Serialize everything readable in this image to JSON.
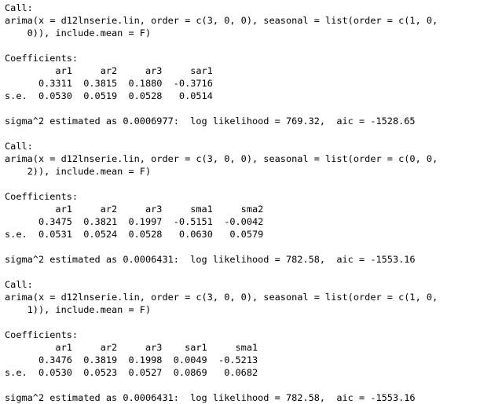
{
  "models": [
    {
      "call_label": "Call:",
      "call_line1": "arima(x = d12lnserie.lin, order = c(3, 0, 0), seasonal = list(order = c(1, 0,",
      "call_line2": "    0)), include.mean = F)",
      "coef_label": "Coefficients:",
      "coef_header": "         ar1     ar2     ar3     sar1",
      "coef_values": "      0.3311  0.3815  0.1880  -0.3716",
      "coef_se": "s.e.  0.0530  0.0519  0.0528   0.0514",
      "summary": "sigma^2 estimated as 0.0006977:  log likelihood = 769.32,  aic = -1528.65"
    },
    {
      "call_label": "Call:",
      "call_line1": "arima(x = d12lnserie.lin, order = c(3, 0, 0), seasonal = list(order = c(0, 0,",
      "call_line2": "    2)), include.mean = F)",
      "coef_label": "Coefficients:",
      "coef_header": "         ar1     ar2     ar3     sma1     sma2",
      "coef_values": "      0.3475  0.3821  0.1997  -0.5151  -0.0042",
      "coef_se": "s.e.  0.0531  0.0524  0.0528   0.0630   0.0579",
      "summary": "sigma^2 estimated as 0.0006431:  log likelihood = 782.58,  aic = -1553.16"
    },
    {
      "call_label": "Call:",
      "call_line1": "arima(x = d12lnserie.lin, order = c(3, 0, 0), seasonal = list(order = c(1, 0,",
      "call_line2": "    1)), include.mean = F)",
      "coef_label": "Coefficients:",
      "coef_header": "         ar1     ar2     ar3    sar1     sma1",
      "coef_values": "      0.3476  0.3819  0.1998  0.0049  -0.5213",
      "coef_se": "s.e.  0.0530  0.0523  0.0527  0.0869   0.0682",
      "summary": "sigma^2 estimated as 0.0006431:  log likelihood = 782.58,  aic = -1553.16"
    }
  ]
}
